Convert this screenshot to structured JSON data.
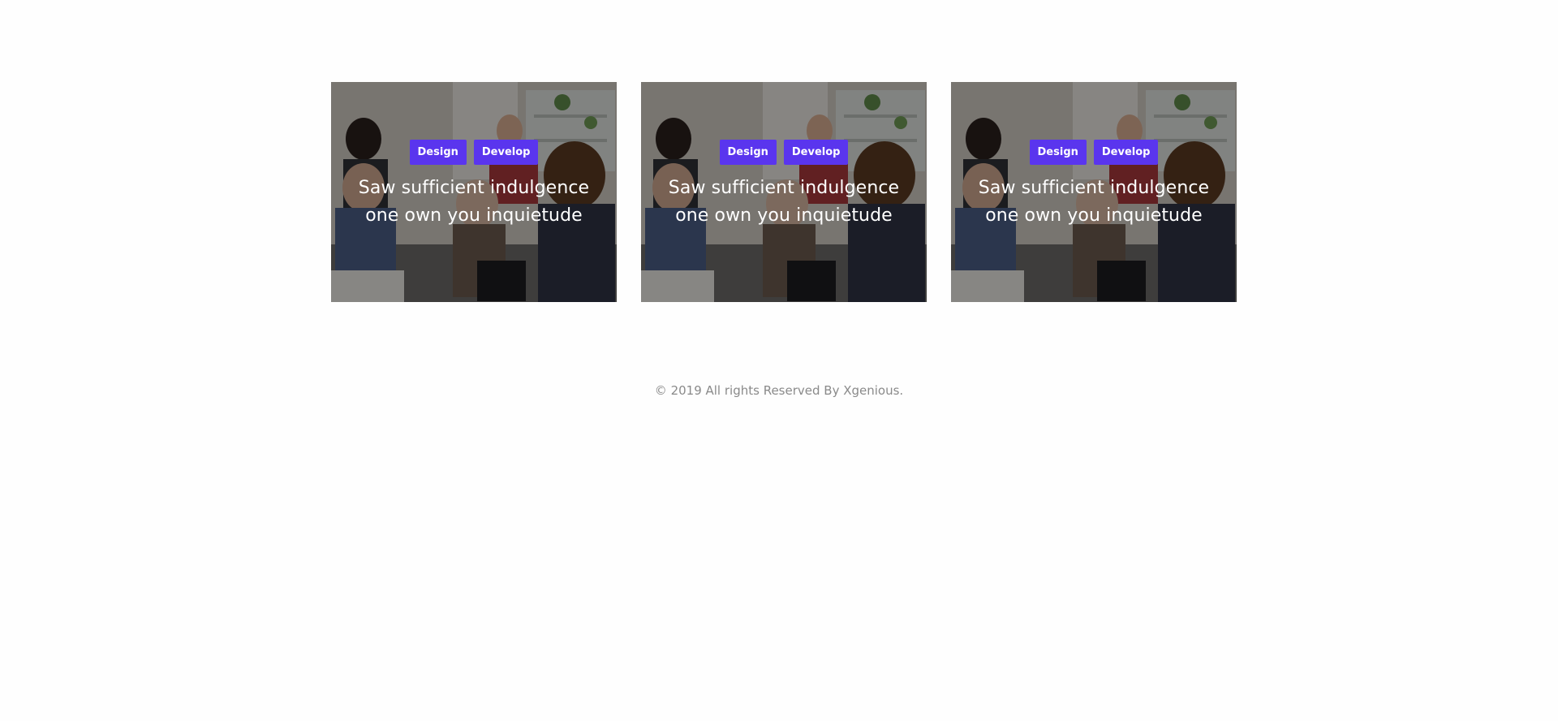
{
  "colors": {
    "page_background": "#fefefe",
    "tag_background": "#5a35ee",
    "title_text": "#ffffff",
    "footer_text": "#8a8a8a"
  },
  "cards": [
    {
      "image": "team-meeting-photo",
      "tags": [
        {
          "label": "Design"
        },
        {
          "label": "Develop"
        }
      ],
      "title": "Saw sufficient indulgence one own you inquietude"
    },
    {
      "image": "team-meeting-photo",
      "tags": [
        {
          "label": "Design"
        },
        {
          "label": "Develop"
        }
      ],
      "title": "Saw sufficient indulgence one own you inquietude"
    },
    {
      "image": "team-meeting-photo",
      "tags": [
        {
          "label": "Design"
        },
        {
          "label": "Develop"
        }
      ],
      "title": "Saw sufficient indulgence one own you inquietude"
    }
  ],
  "footer": {
    "copyright_text": "© 2019 All rights Reserved By Xgenious."
  }
}
